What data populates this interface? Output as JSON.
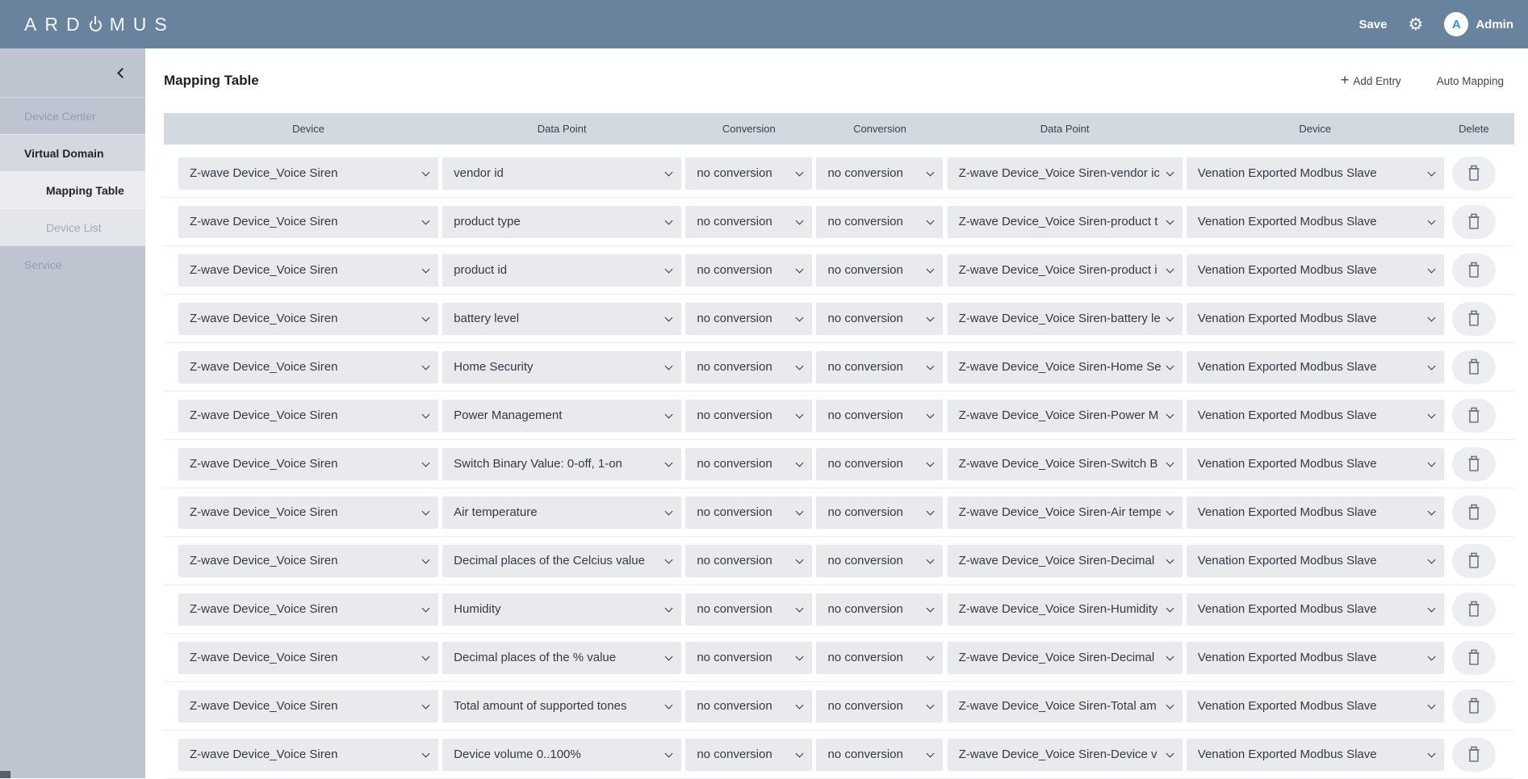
{
  "topbar": {
    "logo_prefix": "ARD",
    "logo_suffix": "MUS",
    "save_label": "Save",
    "user_initial": "A",
    "user_name": "Admin"
  },
  "sidebar": {
    "items": [
      {
        "id": "device-center",
        "label": "Device Center",
        "state": "dim-base"
      },
      {
        "id": "virtual-domain",
        "label": "Virtual Domain",
        "state": "active"
      },
      {
        "id": "mapping-table",
        "label": "Mapping Table",
        "state": "active-sub"
      },
      {
        "id": "device-list",
        "label": "Device List",
        "state": "dim-sub"
      },
      {
        "id": "service",
        "label": "Service",
        "state": "dim-base"
      }
    ]
  },
  "page": {
    "title": "Mapping Table",
    "add_entry_label": "Add Entry",
    "add_entry_plus": "+",
    "auto_mapping_label": "Auto Mapping"
  },
  "table": {
    "headers": [
      "Device",
      "Data Point",
      "Conversion",
      "Conversion",
      "Data Point",
      "Device",
      "Delete"
    ],
    "rows": [
      {
        "device": "Z-wave Device_Voice Siren",
        "data_point": "vendor id",
        "conversion_1": "no conversion",
        "conversion_2": "no conversion",
        "target_data_point": "Z-wave Device_Voice Siren-vendor ic",
        "target_device": "Venation Exported Modbus Slave"
      },
      {
        "device": "Z-wave Device_Voice Siren",
        "data_point": "product type",
        "conversion_1": "no conversion",
        "conversion_2": "no conversion",
        "target_data_point": "Z-wave Device_Voice Siren-product t",
        "target_device": "Venation Exported Modbus Slave"
      },
      {
        "device": "Z-wave Device_Voice Siren",
        "data_point": "product id",
        "conversion_1": "no conversion",
        "conversion_2": "no conversion",
        "target_data_point": "Z-wave Device_Voice Siren-product i",
        "target_device": "Venation Exported Modbus Slave"
      },
      {
        "device": "Z-wave Device_Voice Siren",
        "data_point": "battery level",
        "conversion_1": "no conversion",
        "conversion_2": "no conversion",
        "target_data_point": "Z-wave Device_Voice Siren-battery le",
        "target_device": "Venation Exported Modbus Slave"
      },
      {
        "device": "Z-wave Device_Voice Siren",
        "data_point": "Home Security",
        "conversion_1": "no conversion",
        "conversion_2": "no conversion",
        "target_data_point": "Z-wave Device_Voice Siren-Home Se",
        "target_device": "Venation Exported Modbus Slave"
      },
      {
        "device": "Z-wave Device_Voice Siren",
        "data_point": "Power Management",
        "conversion_1": "no conversion",
        "conversion_2": "no conversion",
        "target_data_point": "Z-wave Device_Voice Siren-Power M",
        "target_device": "Venation Exported Modbus Slave"
      },
      {
        "device": "Z-wave Device_Voice Siren",
        "data_point": "Switch Binary Value: 0-off, 1-on",
        "conversion_1": "no conversion",
        "conversion_2": "no conversion",
        "target_data_point": "Z-wave Device_Voice Siren-Switch B",
        "target_device": "Venation Exported Modbus Slave"
      },
      {
        "device": "Z-wave Device_Voice Siren",
        "data_point": "Air temperature",
        "conversion_1": "no conversion",
        "conversion_2": "no conversion",
        "target_data_point": "Z-wave Device_Voice Siren-Air tempe",
        "target_device": "Venation Exported Modbus Slave"
      },
      {
        "device": "Z-wave Device_Voice Siren",
        "data_point": "Decimal places of the Celcius value",
        "conversion_1": "no conversion",
        "conversion_2": "no conversion",
        "target_data_point": "Z-wave Device_Voice Siren-Decimal",
        "target_device": "Venation Exported Modbus Slave"
      },
      {
        "device": "Z-wave Device_Voice Siren",
        "data_point": "Humidity",
        "conversion_1": "no conversion",
        "conversion_2": "no conversion",
        "target_data_point": "Z-wave Device_Voice Siren-Humidity",
        "target_device": "Venation Exported Modbus Slave"
      },
      {
        "device": "Z-wave Device_Voice Siren",
        "data_point": "Decimal places of the % value",
        "conversion_1": "no conversion",
        "conversion_2": "no conversion",
        "target_data_point": "Z-wave Device_Voice Siren-Decimal",
        "target_device": "Venation Exported Modbus Slave"
      },
      {
        "device": "Z-wave Device_Voice Siren",
        "data_point": "Total amount of supported tones",
        "conversion_1": "no conversion",
        "conversion_2": "no conversion",
        "target_data_point": "Z-wave Device_Voice Siren-Total am",
        "target_device": "Venation Exported Modbus Slave"
      },
      {
        "device": "Z-wave Device_Voice Siren",
        "data_point": "Device volume 0..100%",
        "conversion_1": "no conversion",
        "conversion_2": "no conversion",
        "target_data_point": "Z-wave Device_Voice Siren-Device v",
        "target_device": "Venation Exported Modbus Slave"
      }
    ]
  },
  "colors": {
    "topbar": "#69839e",
    "sidebar": "#bec4d0",
    "sidebar_active": "#d4d8e0",
    "sidebar_active_sub": "#eaecf0",
    "table_header": "#d3d9e1",
    "select_bg": "#e8eaed",
    "avatar_letter": "#2395ef"
  }
}
